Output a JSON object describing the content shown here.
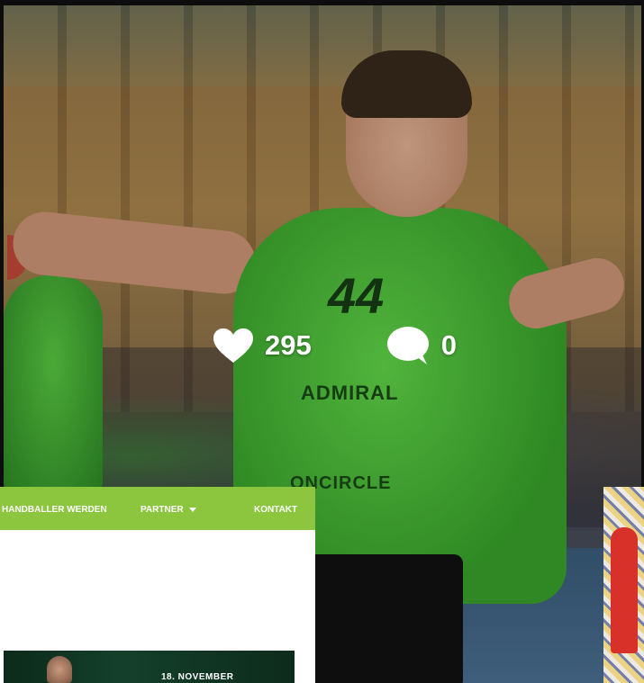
{
  "post": {
    "likes": "295",
    "comments": "0",
    "jersey_number": "44",
    "sponsors": [
      "ADMIRAL",
      "ONCIRCLE"
    ],
    "icons": {
      "like": "heart-icon",
      "comment": "comment-bubble-icon"
    }
  },
  "website": {
    "nav": {
      "item1": "HANDBALLER WERDEN",
      "item2": "PARTNER",
      "item3": "KONTAKT"
    },
    "banner_text": "18. NOVEMBER",
    "accent_color": "#8cc63f"
  }
}
